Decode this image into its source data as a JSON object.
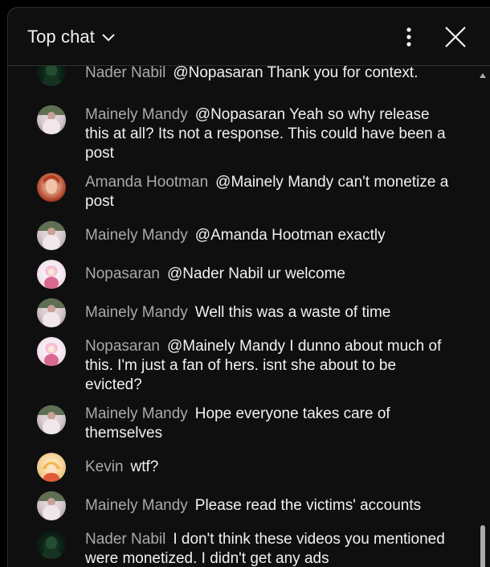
{
  "header": {
    "title": "Top chat"
  },
  "icons": {
    "dropdown": "chevron-down-icon",
    "menu": "more-vertical-icon",
    "close": "close-icon"
  },
  "colors": {
    "background": "#0f0f0f",
    "author": "#aaaaaa",
    "text": "#f1f1f1",
    "divider": "#303030"
  },
  "messages": [
    {
      "author": "Nader Nabil",
      "text": "@Nopasaran Thank you for context."
    },
    {
      "author": "Mainely Mandy",
      "text": "@Nopasaran Yeah so why release this at all? Its not a response. This could have been a post"
    },
    {
      "author": "Amanda Hootman",
      "text": "@Mainely Mandy can't monetize a post"
    },
    {
      "author": "Mainely Mandy",
      "text": "@Amanda Hootman exactly"
    },
    {
      "author": "Nopasaran",
      "text": "@Nader Nabil ur welcome"
    },
    {
      "author": "Mainely Mandy",
      "text": "Well this was a waste of time"
    },
    {
      "author": "Nopasaran",
      "text": "@Mainely Mandy I dunno about much of this. I'm just a fan of hers. isnt she about to be evicted?"
    },
    {
      "author": "Mainely Mandy",
      "text": "Hope everyone takes care of themselves"
    },
    {
      "author": "Kevin",
      "text": "wtf?"
    },
    {
      "author": "Mainely Mandy",
      "text": "Please read the victims' accounts"
    },
    {
      "author": "Nader Nabil",
      "text": "I don't think these videos you mentioned were monetized. I didn't get any ads"
    }
  ]
}
